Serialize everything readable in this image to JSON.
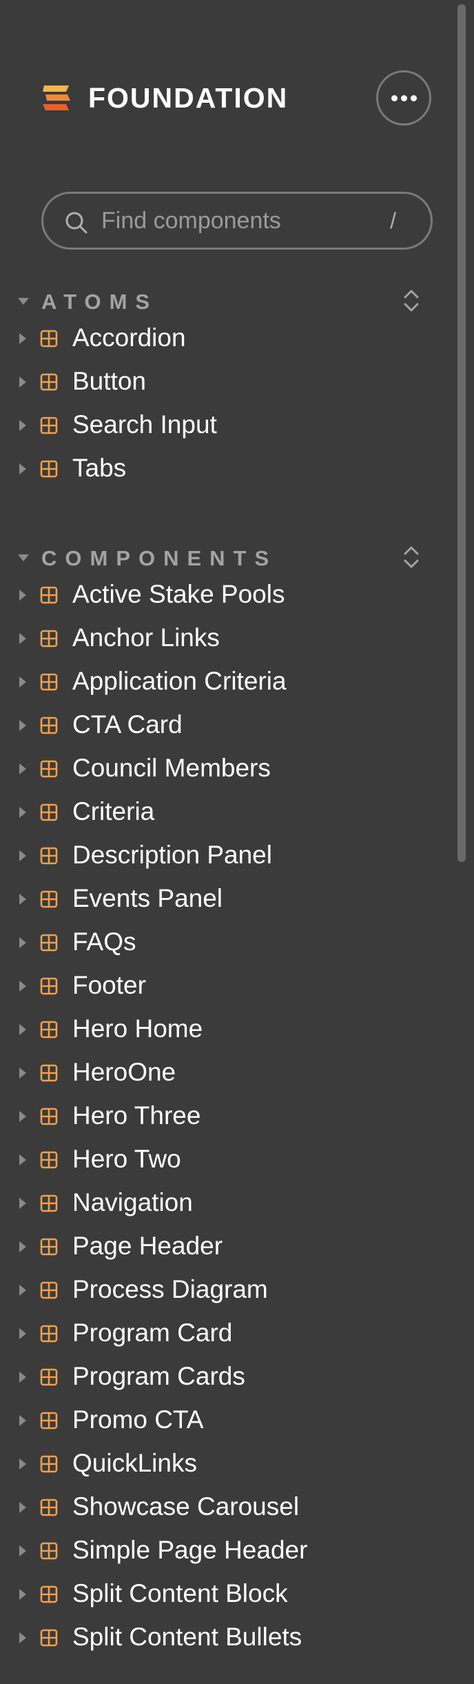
{
  "colors": {
    "background": "#3b3b3b",
    "accent": "#f0a04b",
    "group_title": "#a3a3a3",
    "border": "#7a7a7a"
  },
  "brand": {
    "name": "FOUNDATION",
    "logo_icon": "foundation-logo-icon"
  },
  "header": {
    "more_icon": "ellipsis-icon"
  },
  "search": {
    "placeholder": "Find components",
    "shortcut": "/",
    "icon": "search-icon"
  },
  "groups": [
    {
      "title": "ATOMS",
      "items": [
        {
          "label": "Accordion",
          "icon": "component-icon"
        },
        {
          "label": "Button",
          "icon": "component-icon"
        },
        {
          "label": "Search Input",
          "icon": "component-icon"
        },
        {
          "label": "Tabs",
          "icon": "component-icon"
        }
      ]
    },
    {
      "title": "COMPONENTS",
      "items": [
        {
          "label": "Active Stake Pools",
          "icon": "component-icon"
        },
        {
          "label": "Anchor Links",
          "icon": "component-icon"
        },
        {
          "label": "Application Criteria",
          "icon": "component-icon"
        },
        {
          "label": "CTA Card",
          "icon": "component-icon"
        },
        {
          "label": "Council Members",
          "icon": "component-icon"
        },
        {
          "label": "Criteria",
          "icon": "component-icon"
        },
        {
          "label": "Description Panel",
          "icon": "component-icon"
        },
        {
          "label": "Events Panel",
          "icon": "component-icon"
        },
        {
          "label": "FAQs",
          "icon": "component-icon"
        },
        {
          "label": "Footer",
          "icon": "component-icon"
        },
        {
          "label": "Hero Home",
          "icon": "component-icon"
        },
        {
          "label": "HeroOne",
          "icon": "component-icon"
        },
        {
          "label": "Hero Three",
          "icon": "component-icon"
        },
        {
          "label": "Hero Two",
          "icon": "component-icon"
        },
        {
          "label": "Navigation",
          "icon": "component-icon"
        },
        {
          "label": "Page Header",
          "icon": "component-icon"
        },
        {
          "label": "Process Diagram",
          "icon": "component-icon"
        },
        {
          "label": "Program Card",
          "icon": "component-icon"
        },
        {
          "label": "Program Cards",
          "icon": "component-icon"
        },
        {
          "label": "Promo CTA",
          "icon": "component-icon"
        },
        {
          "label": "QuickLinks",
          "icon": "component-icon"
        },
        {
          "label": "Showcase Carousel",
          "icon": "component-icon"
        },
        {
          "label": "Simple Page Header",
          "icon": "component-icon"
        },
        {
          "label": "Split Content Block",
          "icon": "component-icon"
        },
        {
          "label": "Split Content Bullets",
          "icon": "component-icon"
        }
      ]
    }
  ]
}
